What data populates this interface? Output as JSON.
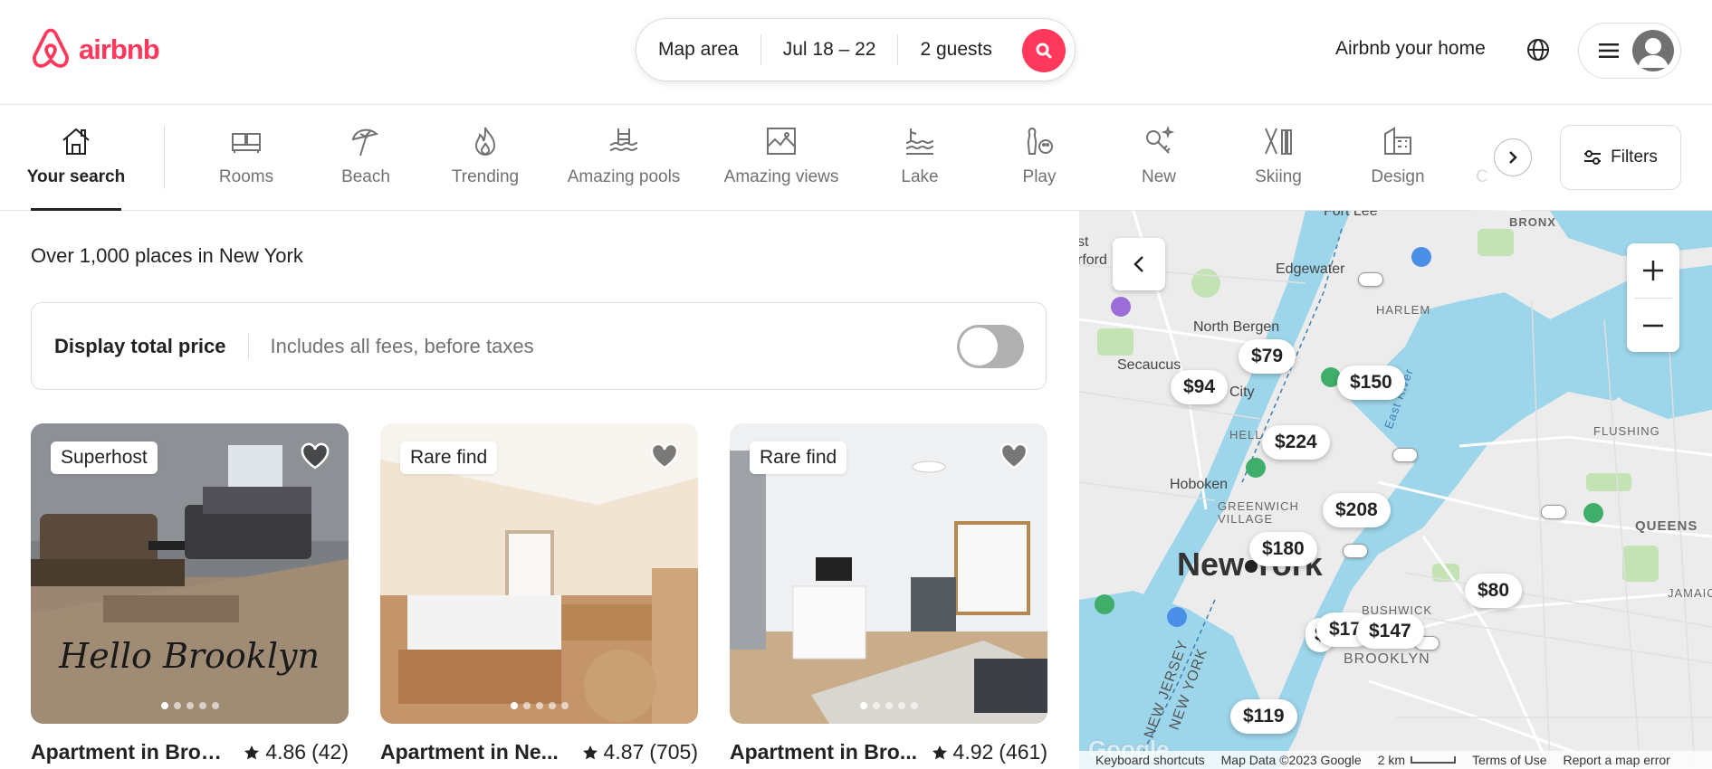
{
  "header": {
    "brand": "airbnb",
    "search": {
      "location": "Map area",
      "dates": "Jul 18 – 22",
      "guests": "2 guests"
    },
    "host_link": "Airbnb your home"
  },
  "categories": [
    {
      "label": "Your search",
      "icon": "home-icon",
      "active": true
    },
    {
      "label": "Rooms",
      "icon": "bed-icon"
    },
    {
      "label": "Beach",
      "icon": "umbrella-icon"
    },
    {
      "label": "Trending",
      "icon": "flame-icon"
    },
    {
      "label": "Amazing pools",
      "icon": "pool-icon"
    },
    {
      "label": "Amazing views",
      "icon": "picture-icon"
    },
    {
      "label": "Lake",
      "icon": "lake-icon"
    },
    {
      "label": "Play",
      "icon": "bowling-icon"
    },
    {
      "label": "New",
      "icon": "key-sparkle-icon"
    },
    {
      "label": "Skiing",
      "icon": "skis-icon"
    },
    {
      "label": "Design",
      "icon": "building-icon"
    },
    {
      "label": "C",
      "icon": "partial-icon"
    }
  ],
  "filters_label": "Filters",
  "results": {
    "count_text": "Over 1,000 places in New York",
    "price_toggle": {
      "title": "Display total price",
      "subtitle": "Includes all fees, before taxes",
      "on": false
    }
  },
  "listings": [
    {
      "badge": "Superhost",
      "title": "Apartment in Broo...",
      "rating": "4.86",
      "reviews": "(42)",
      "image_text": "Hello Brooklyn"
    },
    {
      "badge": "Rare find",
      "title": "Apartment in Ne...",
      "rating": "4.87",
      "reviews": "(705)"
    },
    {
      "badge": "Rare find",
      "title": "Apartment in Bro...",
      "rating": "4.92",
      "reviews": "(461)"
    }
  ],
  "map": {
    "places": [
      "Fort Lee",
      "Edgewater",
      "BRONX",
      "HARLEM",
      "North Bergen",
      "Secaucus",
      "City",
      "HELL",
      "Hoboken",
      "GREENWICH VILLAGE",
      "New York",
      "BUSHWICK",
      "BROOKLYN",
      "QUEENS",
      "FLUSHING",
      "JAMAICA",
      "East River",
      "NEW JERSEY",
      "NEW YORK",
      "st",
      "rford"
    ],
    "prices": [
      "$79",
      "$94",
      "$150",
      "$224",
      "$208",
      "$180",
      "$80",
      "$17",
      "$147",
      "$119",
      "$"
    ],
    "footer": {
      "shortcuts": "Keyboard shortcuts",
      "data": "Map Data ©2023 Google",
      "scale": "2 km",
      "terms": "Terms of Use",
      "report": "Report a map error"
    },
    "google": "Google"
  }
}
